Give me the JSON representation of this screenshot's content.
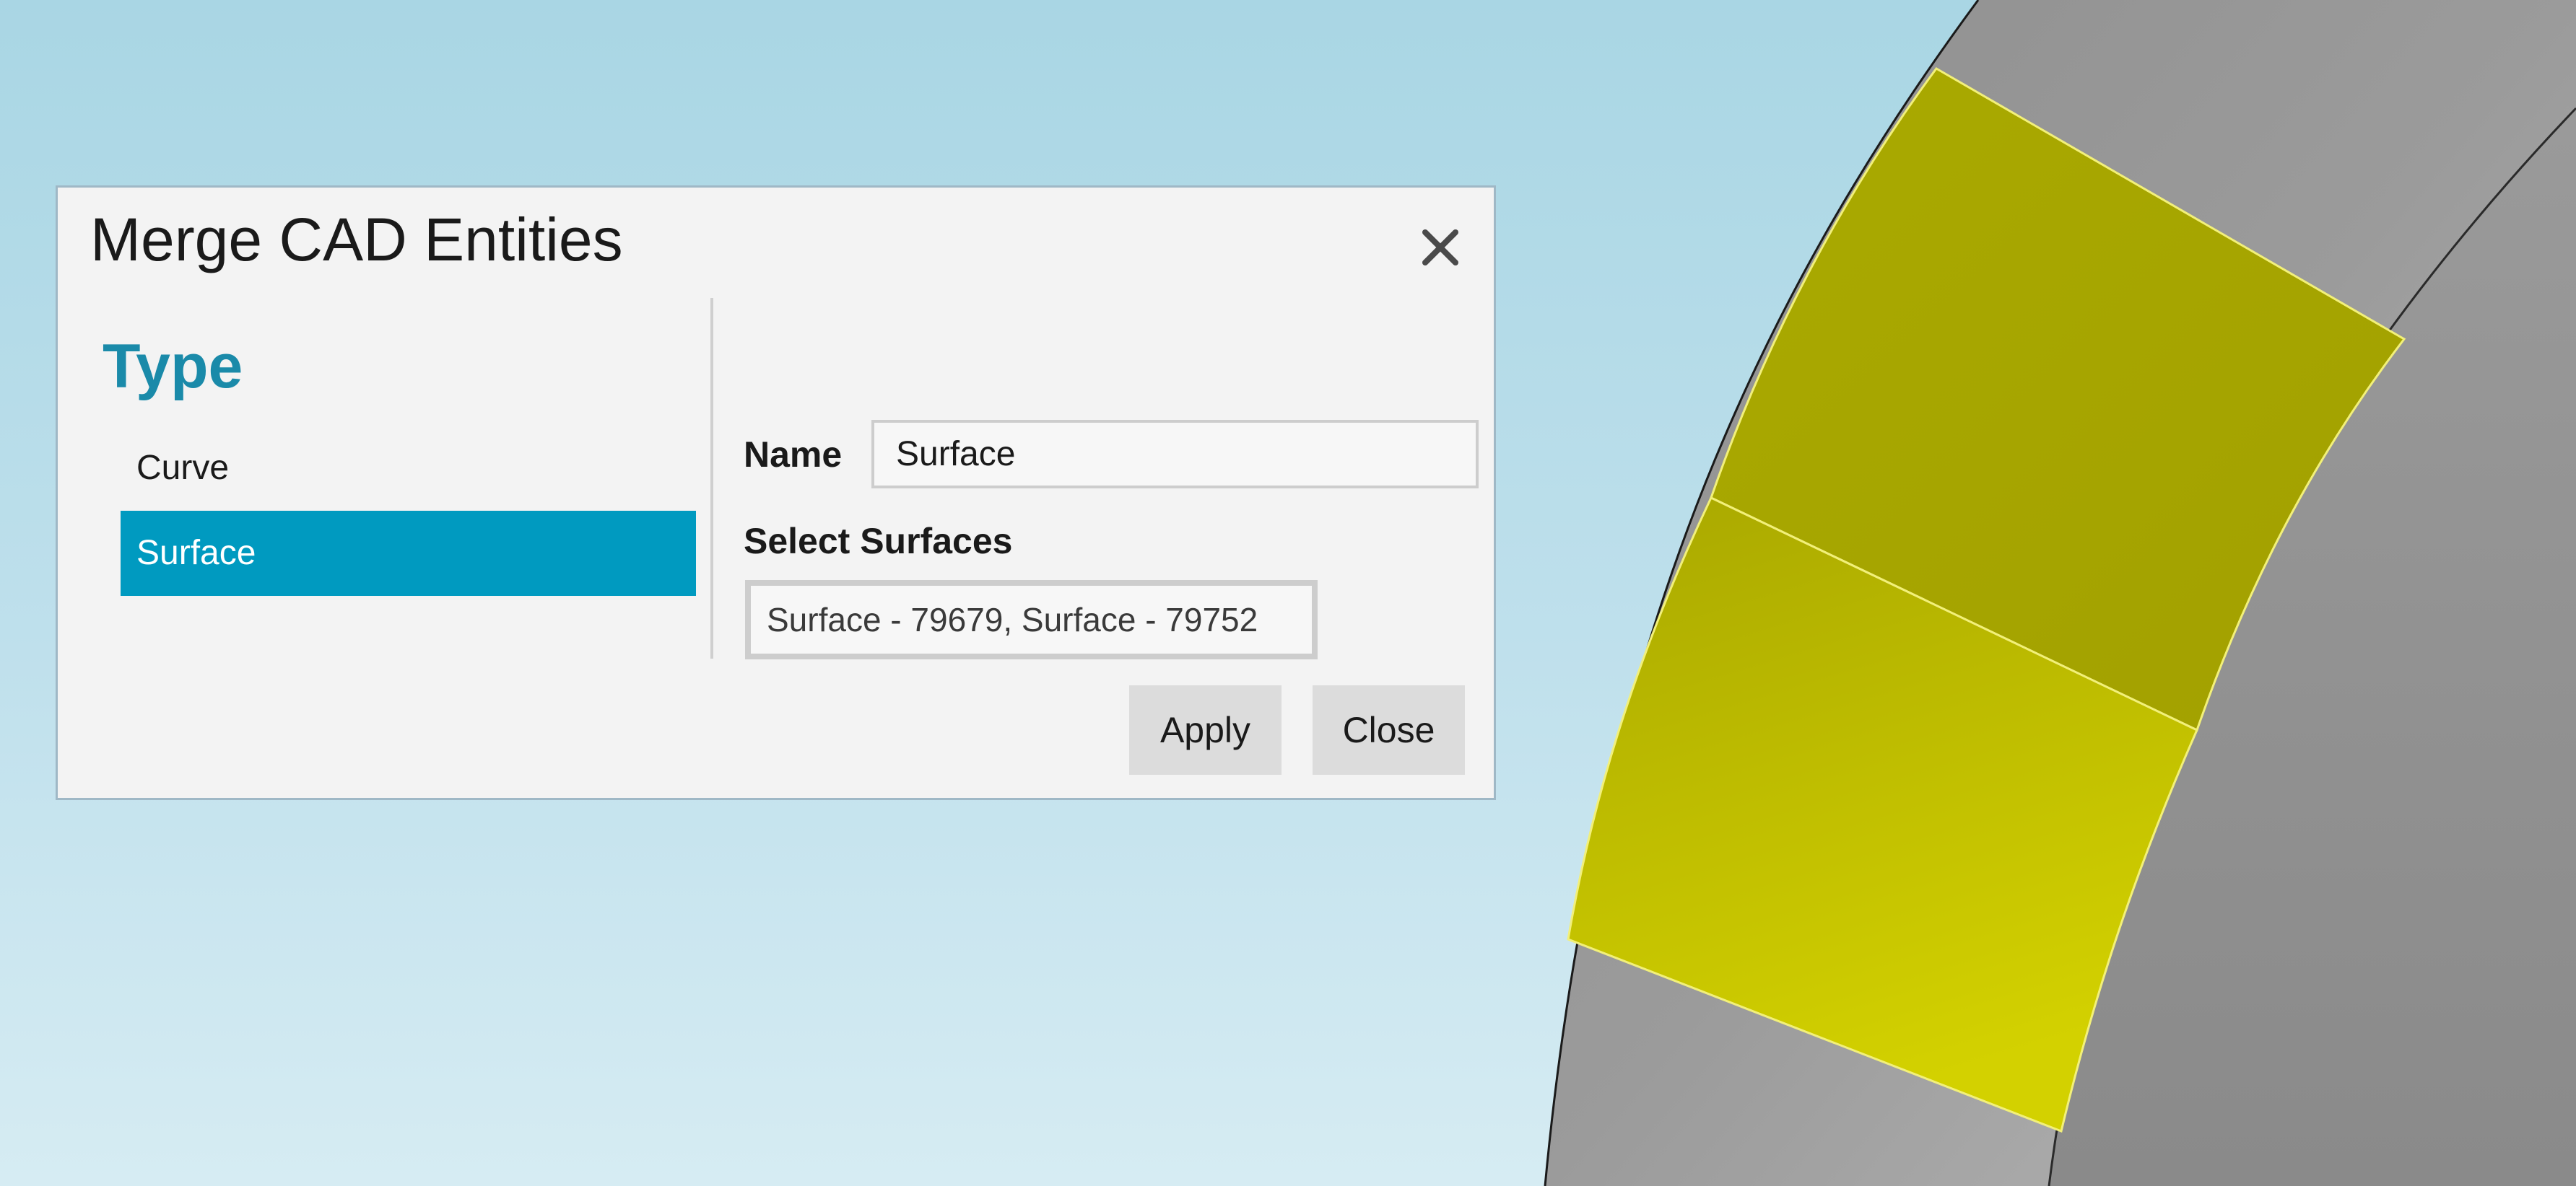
{
  "dialog": {
    "title": "Merge CAD Entities",
    "close_icon": "close-icon"
  },
  "type_panel": {
    "heading": "Type",
    "items": [
      {
        "label": "Curve",
        "selected": false
      },
      {
        "label": "Surface",
        "selected": true
      }
    ]
  },
  "form": {
    "name_label": "Name",
    "name_value": "Surface",
    "select_label": "Select Surfaces",
    "select_value": "Surface - 79679, Surface - 79752"
  },
  "buttons": {
    "apply_label": "Apply",
    "close_label": "Close"
  },
  "colors": {
    "accent": "#009ac0",
    "heading": "#1a8aa9",
    "background_top": "#a9d6e4",
    "background_bottom": "#d6ecf3",
    "selected_face": "#c9c700",
    "model_gray": "#a7a7a7"
  }
}
